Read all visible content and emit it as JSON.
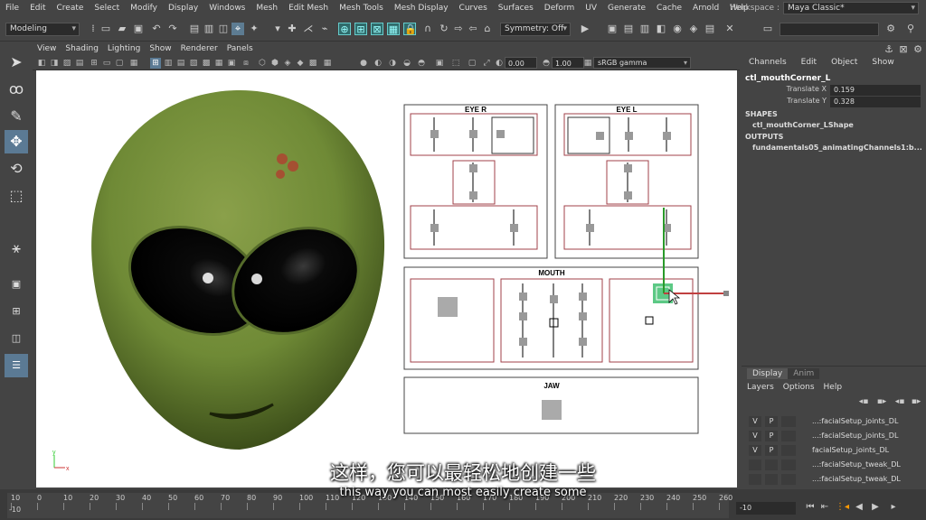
{
  "menubar": {
    "items": [
      "File",
      "Edit",
      "Create",
      "Select",
      "Modify",
      "Display",
      "Windows",
      "Mesh",
      "Edit Mesh",
      "Mesh Tools",
      "Mesh Display",
      "Curves",
      "Surfaces",
      "Deform",
      "UV",
      "Generate",
      "Cache",
      "Arnold",
      "Help"
    ],
    "workspace_label": "Workspace :",
    "workspace_value": "Maya Classic*"
  },
  "shelf": {
    "mode": "Modeling",
    "symmetry": "Symmetry: Off"
  },
  "viewport": {
    "menu": [
      "View",
      "Shading",
      "Lighting",
      "Show",
      "Renderer",
      "Panels"
    ],
    "exposure": "0.00",
    "gamma_value": "1.00",
    "colorspace": "sRGB gamma",
    "panel_labels": {
      "eye_r": "EYE R",
      "eye_l": "EYE L",
      "mouth": "MOUTH",
      "jaw": "JAW"
    }
  },
  "channel_box": {
    "menu": [
      "Channels",
      "Edit",
      "Object",
      "Show"
    ],
    "node": "ctl_mouthCorner_L",
    "attrs": [
      {
        "name": "Translate X",
        "value": "0.159"
      },
      {
        "name": "Translate Y",
        "value": "0.328"
      }
    ],
    "shapes_header": "SHAPES",
    "shape": "ctl_mouthCorner_LShape",
    "outputs_header": "OUTPUTS",
    "output": "fundamentals05_animatingChannels1:b..."
  },
  "layers": {
    "tabs": [
      "Display",
      "Anim"
    ],
    "menu": [
      "Layers",
      "Options",
      "Help"
    ],
    "rows": [
      {
        "v": "V",
        "p": "P",
        "name": "...:facialSetup_joints_DL"
      },
      {
        "v": "V",
        "p": "P",
        "name": "...:facialSetup_joints_DL"
      },
      {
        "v": "V",
        "p": "P",
        "name": "facialSetup_joints_DL"
      },
      {
        "v": "",
        "p": "",
        "name": "...:facialSetup_tweak_DL"
      },
      {
        "v": "",
        "p": "",
        "name": "...:facialSetup_tweak_DL"
      }
    ]
  },
  "timeline": {
    "ticks": [
      "10",
      "0",
      "10",
      "20",
      "30",
      "40",
      "50",
      "60",
      "70",
      "80",
      "90",
      "100",
      "110",
      "120",
      "130",
      "140",
      "150",
      "160",
      "170",
      "180",
      "190",
      "200",
      "210",
      "220",
      "230",
      "240",
      "250",
      "260"
    ],
    "start": "-10",
    "current": "-10"
  },
  "subtitles": {
    "zh": "这样，您可以最轻松地创建一些",
    "en": "this way you can most easily create some"
  },
  "axis": {
    "y": "y",
    "x": "x"
  }
}
